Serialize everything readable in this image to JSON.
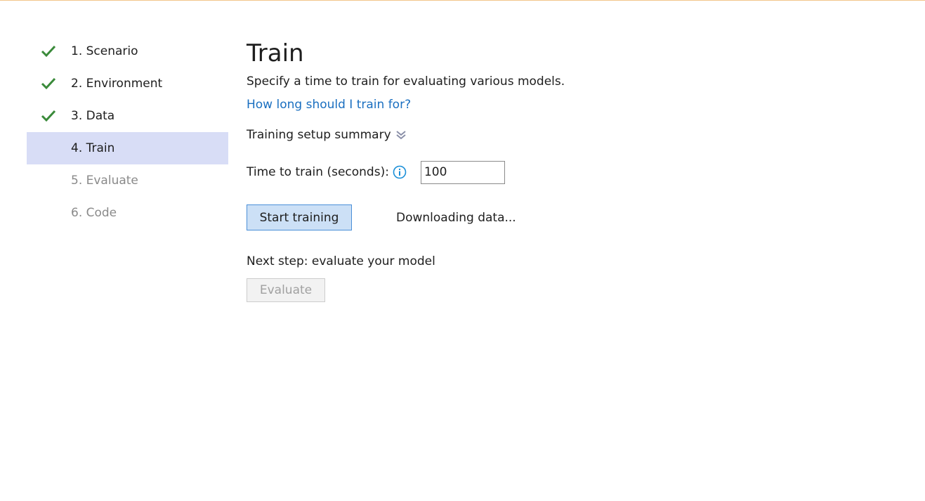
{
  "sidebar": {
    "steps": [
      {
        "label": "1. Scenario",
        "state": "completed"
      },
      {
        "label": "2. Environment",
        "state": "completed"
      },
      {
        "label": "3. Data",
        "state": "completed"
      },
      {
        "label": "4. Train",
        "state": "active"
      },
      {
        "label": "5. Evaluate",
        "state": "disabled"
      },
      {
        "label": "6. Code",
        "state": "disabled"
      }
    ]
  },
  "main": {
    "title": "Train",
    "description": "Specify a time to train for evaluating various models.",
    "help_link": "How long should I train for?",
    "summary_toggle": "Training setup summary",
    "time_label": "Time to train (seconds):",
    "time_value": "100",
    "start_button": "Start training",
    "status": "Downloading data...",
    "next_step": "Next step: evaluate your model",
    "evaluate_button": "Evaluate"
  },
  "colors": {
    "check": "#3a8a3a",
    "active_step_bg": "#d8ddf6",
    "link": "#1a6fc0",
    "info_icon": "#1a8fd8",
    "primary_btn_bg": "#cce0f6",
    "primary_btn_border": "#4a8fd8"
  },
  "icons": {
    "completed": "checkmark-icon",
    "info": "info-icon",
    "summary": "chevron-double-down-icon"
  }
}
